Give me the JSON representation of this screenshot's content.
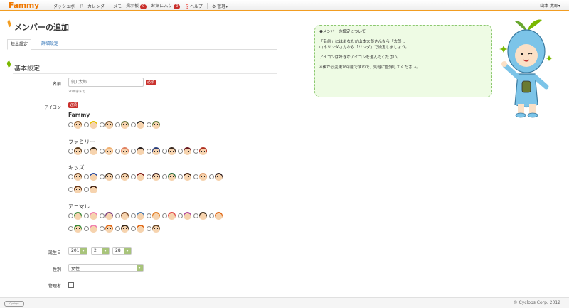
{
  "nav": {
    "logo": "Fammy",
    "items": [
      "ダッシュボード",
      "カレンダー",
      "メモ",
      "掲示板"
    ],
    "board_badge": "0",
    "favorites": "お気に入り",
    "favorites_badge": "0",
    "help": "ヘルプ",
    "admin": "管理▾",
    "user": "山本 太郎▾"
  },
  "page": {
    "title": "メンバーの追加",
    "tabs": [
      "基本設定",
      "詳細設定"
    ],
    "section_title": "基本設定"
  },
  "form": {
    "name_label": "名前",
    "name_placeholder": "例) 太郎",
    "required": "必須",
    "name_hint": "20文字まで",
    "icon_label": "アイコン",
    "icon_groups": [
      {
        "label": "Fammy",
        "rows": [
          [
            "#8a5a2b",
            "#e2c000",
            "#7b5b3b",
            "#6b7a44",
            "#333333",
            "#5a7a3a"
          ]
        ]
      },
      {
        "label": "ファミリー",
        "rows": [
          [
            "#5a3a1a",
            "#3a2a1a",
            "#f0b070",
            "#e08060",
            "#2a2020",
            "#283c78",
            "#3a2a20",
            "#6a1a20",
            "#b03020"
          ]
        ]
      },
      {
        "label": "キッズ",
        "rows": [
          [
            "#6a4020",
            "#3050a0",
            "#3a2a1a",
            "#5a3a20",
            "#802020",
            "#3a2020",
            "#2a6a3a",
            "#4a2a1a",
            "#e0a070",
            "#3a2a2a"
          ],
          [
            "#6a3a1a",
            "#4a2a1a"
          ]
        ]
      },
      {
        "label": "アニマル",
        "rows": [
          [
            "#3a8a3a",
            "#f080b0",
            "#7a3a7a",
            "#7a4a2a",
            "#4a7ab0",
            "#e07a20",
            "#e04a4a",
            "#b04aa0",
            "#3a2a1a",
            "#e06a1a"
          ],
          [
            "#3a8a3a",
            "#f080b0",
            "#e06a1a",
            "#3a2a1a",
            "#e06a1a",
            "#6a4a2a"
          ]
        ]
      }
    ],
    "birthday_label": "誕生日",
    "year": "201",
    "month": "2",
    "day": "28",
    "gender_label": "性別",
    "gender": "女性",
    "admin_label": "管理者"
  },
  "info": {
    "title": "❶メンバーの設定について",
    "line1": "「名前」にはあなたが山本太郎さんなら「太郎」、",
    "line2": "山本リンダさんなら「リンダ」で設定しましょう。",
    "line3": "アイコンは好きなアイコンを選んでください。",
    "line4": "※後から変更が可能ですので、気軽に登録してください。"
  },
  "footer": {
    "logo_text": "Cyclops",
    "copyright": "© Cyclops Corp. 2012"
  }
}
